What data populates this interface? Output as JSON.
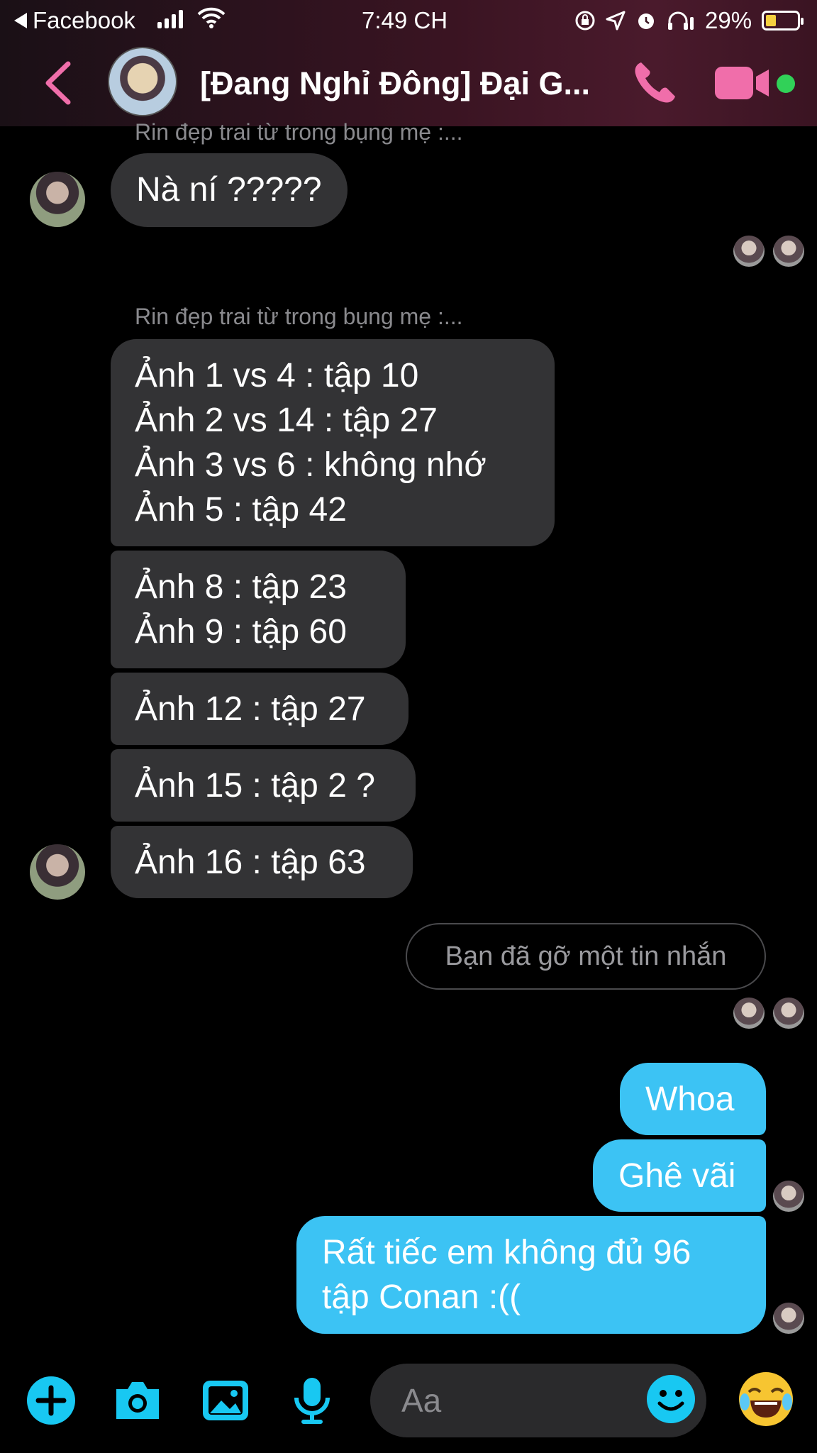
{
  "status_bar": {
    "back_app": "Facebook",
    "time": "7:49 CH",
    "battery_pct": "29%"
  },
  "header": {
    "title": "[Đang Nghỉ Đông] Đại G..."
  },
  "messages": {
    "m1": {
      "sender": "Rin đẹp trai từ trong bụng mẹ :...",
      "text": "Nà ní ?????"
    },
    "m2": {
      "sender": "Rin đẹp trai từ trong bụng mẹ :...",
      "lines": [
        "Ảnh 1 vs 4 : tập 10",
        "Ảnh 2 vs 14 : tập 27",
        "Ảnh 3 vs 6 : không nhớ",
        "Ảnh 5 : tập 42"
      ]
    },
    "m3": {
      "lines": [
        "Ảnh 8 : tập 23",
        "Ảnh 9 : tập 60"
      ]
    },
    "m4": {
      "text": "Ảnh 12 : tập 27"
    },
    "m5": {
      "text": "Ảnh 15 : tập 2 ?"
    },
    "m6": {
      "text": "Ảnh 16 : tập 63"
    },
    "unsent": "Bạn đã gỡ một tin nhắn",
    "o1": {
      "text": "Whoa"
    },
    "o2": {
      "text": "Ghê vãi"
    },
    "o3": {
      "lines": [
        "Rất tiếc em không đủ 96",
        "tập Conan :(("
      ]
    }
  },
  "composer": {
    "placeholder": "Aa"
  },
  "colors": {
    "accent_pink": "#f06eaa",
    "accent_blue": "#18c8f2",
    "bubble_out": "#3cc3f4",
    "bubble_in": "#333335",
    "online": "#31d158"
  }
}
